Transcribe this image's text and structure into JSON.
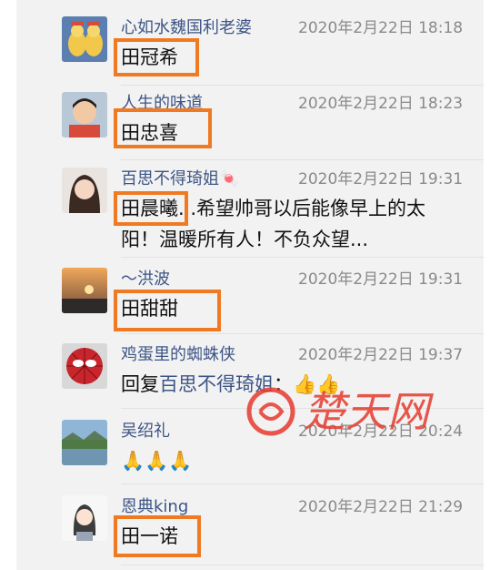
{
  "comments": [
    {
      "name": "心如水魏国利老婆",
      "time": "2020年2月22日 18:18",
      "content": "田冠希"
    },
    {
      "name": "人生的味道",
      "time": "2020年2月22日 18:23",
      "content": "田忠喜"
    },
    {
      "name": "百思不得琦姐",
      "name_emoji": "🍬",
      "time": "2020年2月22日 19:31",
      "content": "田晨曦...希望帅哥以后能像早上的太阳！温暖所有人！不负众望..."
    },
    {
      "name": "～洪波",
      "time": "2020年2月22日 19:31",
      "content": "田甜甜"
    },
    {
      "name": "鸡蛋里的蜘蛛侠",
      "time": "2020年2月22日 19:37",
      "reply_prefix": "回复",
      "reply_to": "百思不得琦姐",
      "reply_suffix": "：",
      "content_emoji": "👍👍"
    },
    {
      "name": "吴绍礼",
      "time": "2020年2月22日 20:24",
      "content_emoji": "🙏🙏🙏"
    },
    {
      "name": "恩典king",
      "time": "2020年2月22日 21:29",
      "content": "田一诺"
    }
  ],
  "watermark": "楚天网",
  "colors": {
    "highlight": "#f07a22",
    "name": "#3d5585",
    "watermark": "#e63a2e"
  }
}
